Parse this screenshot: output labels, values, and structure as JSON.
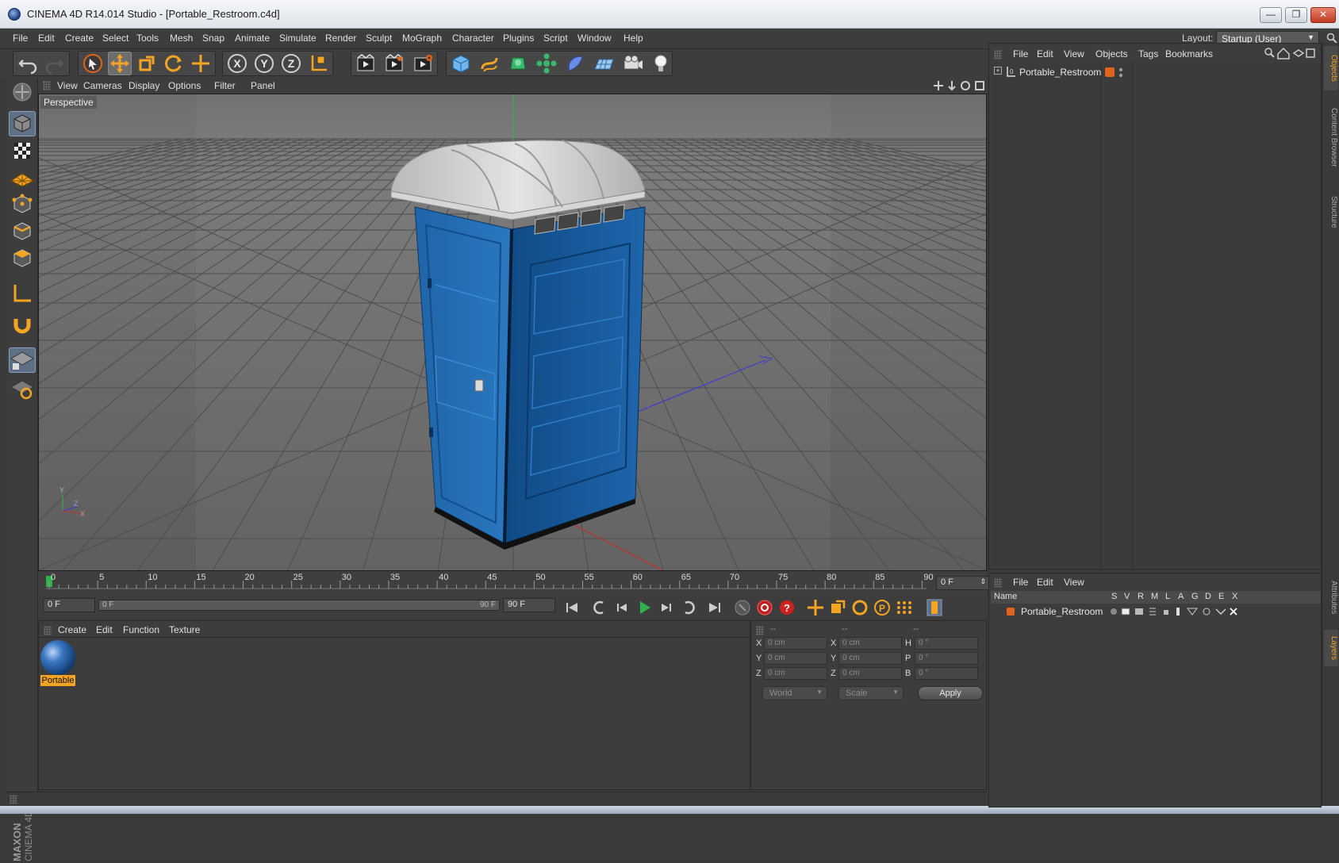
{
  "window": {
    "title": "CINEMA 4D R14.014 Studio - [Portable_Restroom.c4d]",
    "minimize": "—",
    "restore": "❐",
    "close": "✕"
  },
  "menubar": {
    "items": [
      "File",
      "Edit",
      "Create",
      "Select",
      "Tools",
      "Mesh",
      "Snap",
      "Animate",
      "Simulate",
      "Render",
      "Sculpt",
      "MoGraph",
      "Character",
      "Plugins",
      "Script",
      "Window",
      "Help"
    ],
    "layout_label": "Layout:",
    "layout_value": "Startup (User)"
  },
  "toolbar": {
    "icons": [
      "undo-icon",
      "redo-icon",
      "live-selection-icon",
      "move-icon",
      "scale-icon",
      "rotate-icon",
      "recent-tool-icon",
      "x-axis-lock-icon",
      "y-axis-lock-icon",
      "z-axis-lock-icon",
      "coordinate-system-icon",
      "render-view-icon",
      "render-picture-viewer-icon",
      "edit-render-settings-icon",
      "cube-icon",
      "spline-icon",
      "nurbs-icon",
      "array-icon",
      "deformer-icon",
      "floor-icon",
      "camera-icon",
      "light-icon"
    ],
    "axis_x": "X",
    "axis_y": "Y",
    "axis_z": "Z"
  },
  "viewport": {
    "menu": [
      "View",
      "Cameras",
      "Display",
      "Options",
      "Filter",
      "Panel"
    ],
    "camera_label": "Perspective",
    "axis_y": "Y",
    "axis_z": "Z",
    "axis_x": "X"
  },
  "timeline": {
    "ticks": [
      "0",
      "5",
      "10",
      "15",
      "20",
      "25",
      "30",
      "35",
      "40",
      "45",
      "50",
      "55",
      "60",
      "65",
      "70",
      "75",
      "80",
      "85",
      "90"
    ],
    "current_frame": "0 F",
    "start_field": "0 F",
    "range_start": "0 F",
    "range_end": "90 F",
    "end_field": "90 F"
  },
  "material_manager": {
    "menu": [
      "Create",
      "Edit",
      "Function",
      "Texture"
    ],
    "materials": [
      {
        "name": "Portable"
      }
    ]
  },
  "coordinates": {
    "headers": [
      "--",
      "--",
      "--"
    ],
    "rows": [
      {
        "pos_axis": "X",
        "pos": "0 cm",
        "size_axis": "X",
        "size": "0 cm",
        "rot_axis": "H",
        "rot": "0 °"
      },
      {
        "pos_axis": "Y",
        "pos": "0 cm",
        "size_axis": "Y",
        "size": "0 cm",
        "rot_axis": "P",
        "rot": "0 °"
      },
      {
        "pos_axis": "Z",
        "pos": "0 cm",
        "size_axis": "Z",
        "size": "0 cm",
        "rot_axis": "B",
        "rot": "0 °"
      }
    ],
    "mode": "World",
    "size_mode": "Scale",
    "apply": "Apply"
  },
  "object_manager": {
    "menu": [
      "File",
      "Edit",
      "View",
      "Objects",
      "Tags",
      "Bookmarks"
    ],
    "objects": [
      {
        "name": "Portable_Restroom",
        "layer_color": "#e0641c"
      }
    ]
  },
  "layer_manager": {
    "menu": [
      "File",
      "Edit",
      "View"
    ],
    "columns": [
      "Name",
      "S",
      "V",
      "R",
      "M",
      "L",
      "A",
      "G",
      "D",
      "E",
      "X"
    ],
    "layers": [
      {
        "name": "Portable_Restroom",
        "color": "#e0641c"
      }
    ]
  },
  "side_tabs": [
    "Objects",
    "Content Browser",
    "Structure",
    "Attributes",
    "Layers"
  ],
  "colors": {
    "accent": "#f2a422",
    "restroom_blue": "#1f64a8",
    "roof_grey": "#c9c9c9"
  }
}
